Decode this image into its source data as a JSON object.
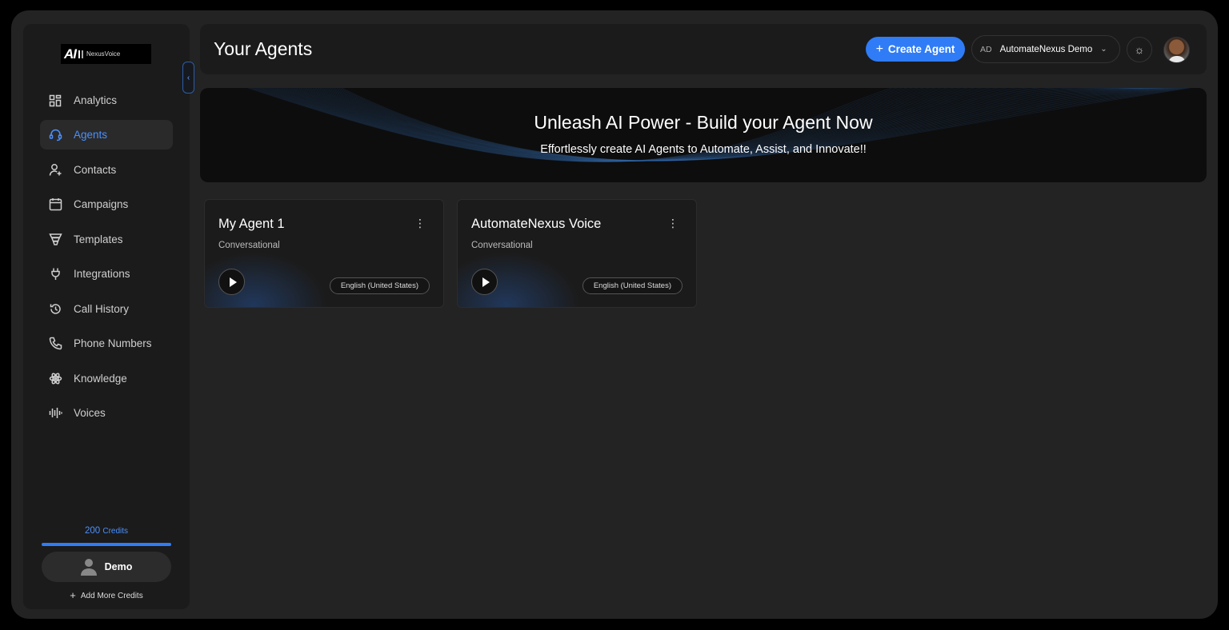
{
  "brand": {
    "logo_mark": "AI",
    "logo_name": "NexusVoice"
  },
  "sidebar": {
    "items": [
      {
        "label": "Analytics",
        "icon": "grid-icon"
      },
      {
        "label": "Agents",
        "icon": "headset-icon",
        "active": true
      },
      {
        "label": "Contacts",
        "icon": "user-plus-icon"
      },
      {
        "label": "Campaigns",
        "icon": "calendar-icon"
      },
      {
        "label": "Templates",
        "icon": "funnel-icon"
      },
      {
        "label": "Integrations",
        "icon": "plug-icon"
      },
      {
        "label": "Call History",
        "icon": "history-icon"
      },
      {
        "label": "Phone Numbers",
        "icon": "phone-icon"
      },
      {
        "label": "Knowledge",
        "icon": "atom-icon"
      },
      {
        "label": "Voices",
        "icon": "waveform-icon"
      }
    ],
    "credits_amount": "200",
    "credits_label": "Credits",
    "credits_fill": 1.0,
    "user_name": "Demo",
    "add_credits_label": "Add More Credits"
  },
  "header": {
    "title": "Your Agents",
    "create_label": "Create Agent",
    "account_initials": "AD",
    "account_name": "AutomateNexus Demo"
  },
  "banner": {
    "title": "Unleash AI Power - Build your Agent Now",
    "subtitle": "Effortlessly create AI Agents to Automate, Assist, and Innovate!!"
  },
  "agents": [
    {
      "name": "My Agent 1",
      "type": "Conversational",
      "language": "English (United States)"
    },
    {
      "name": "AutomateNexus Voice",
      "type": "Conversational",
      "language": "English (United States)"
    }
  ],
  "colors": {
    "accent": "#2f7cf6",
    "active_text": "#4a90ff",
    "background": "#232323",
    "panel": "#1b1b1b"
  }
}
